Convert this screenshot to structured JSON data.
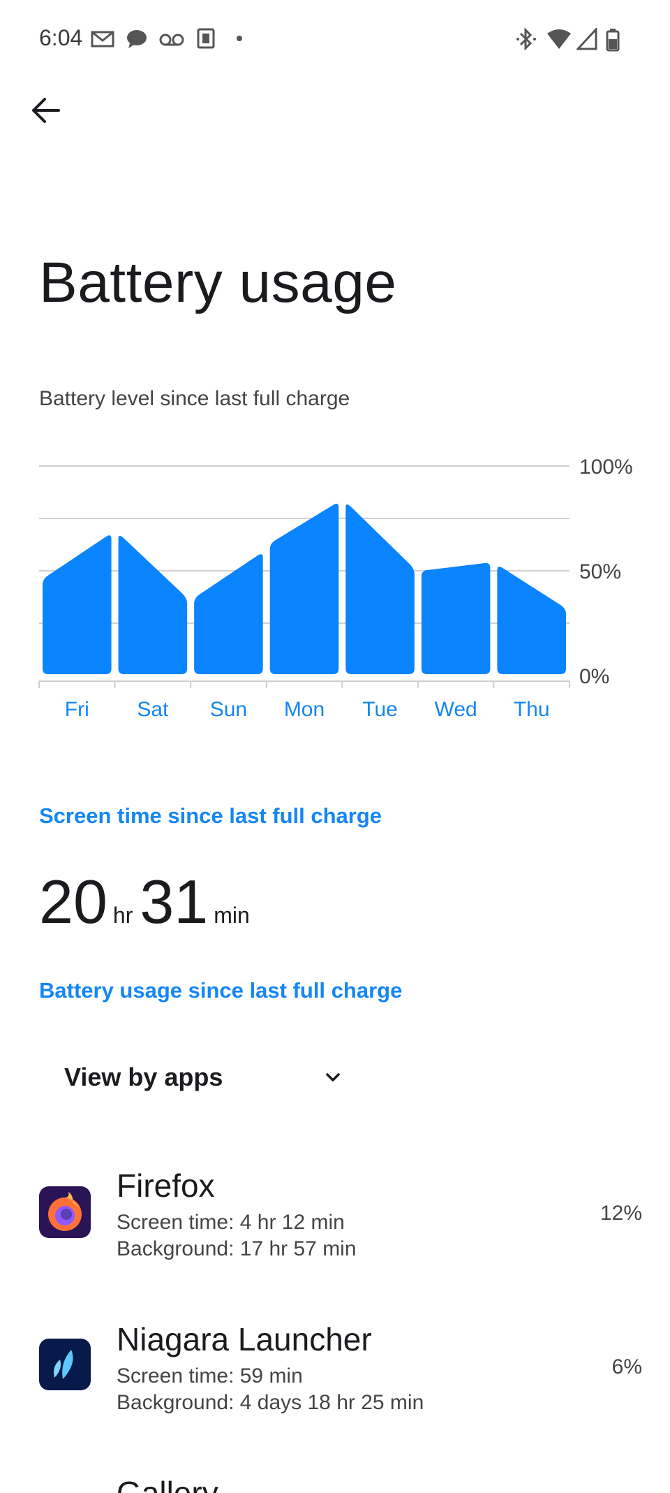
{
  "status_bar": {
    "time": "6:04",
    "icons": [
      "gmail-icon",
      "chat-icon",
      "voicemail-icon",
      "keep-icon",
      "dot-icon",
      "bluetooth-icon",
      "wifi-icon",
      "signal-icon",
      "battery-icon"
    ]
  },
  "header": {
    "back_icon": "arrow-left-icon",
    "title": "Battery usage"
  },
  "chart_section": {
    "label": "Battery level since last full charge"
  },
  "chart_data": {
    "type": "area",
    "categories": [
      "Fri",
      "Sat",
      "Sun",
      "Mon",
      "Tue",
      "Wed",
      "Thu"
    ],
    "y_ticks": [
      "100%",
      "50%",
      "0%"
    ],
    "ylim": [
      0,
      100
    ],
    "accent_color": "#0a84ff",
    "series": [
      {
        "segments": [
          [
            46,
            68
          ],
          [
            68,
            37
          ],
          [
            37,
            59
          ],
          [
            63,
            83
          ],
          [
            83,
            51
          ],
          [
            50,
            54
          ],
          [
            53,
            32
          ]
        ]
      }
    ],
    "grid": true
  },
  "screen_time": {
    "label": "Screen time since last full charge",
    "hours": "20",
    "hours_unit": "hr",
    "minutes": "31",
    "minutes_unit": "min"
  },
  "usage": {
    "label": "Battery usage since last full charge",
    "view_selector": "View by apps"
  },
  "apps": [
    {
      "name": "Firefox",
      "screen_time": "Screen time: 4 hr 12 min",
      "background": "Background: 17 hr 57 min",
      "percent": "12%",
      "icon": "firefox-icon"
    },
    {
      "name": "Niagara Launcher",
      "screen_time": "Screen time: 59 min",
      "background": "Background: 4 days 18 hr 25 min",
      "percent": "6%",
      "icon": "niagara-launcher-icon"
    },
    {
      "name": "Gallery",
      "icon": "gallery-icon"
    }
  ],
  "colors": {
    "accent": "#1486f5",
    "chart_fill": "#0a84ff"
  }
}
